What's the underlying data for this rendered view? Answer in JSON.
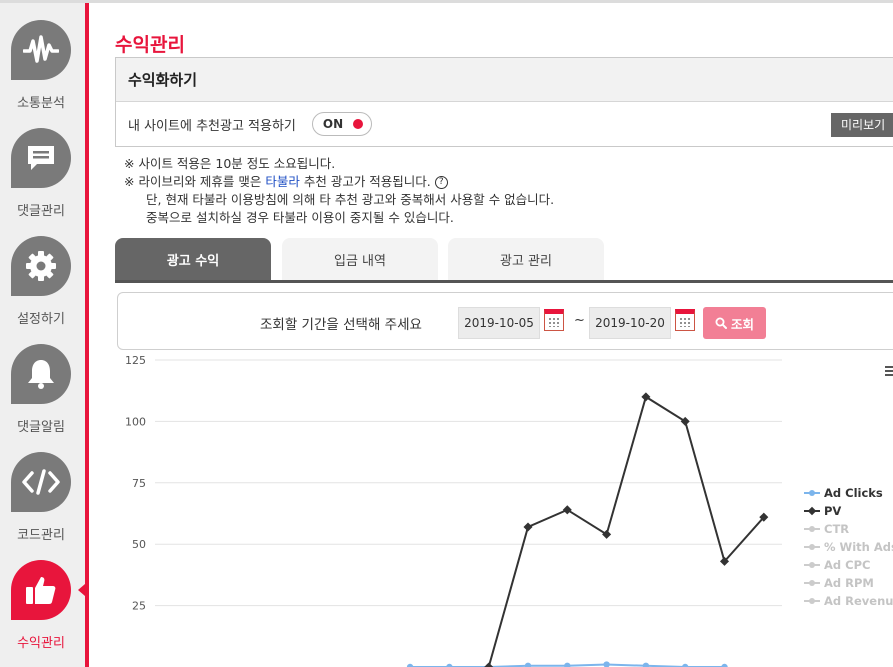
{
  "sidebar": {
    "items": [
      {
        "label": "소통분석",
        "icon": "waveform-icon",
        "active": false
      },
      {
        "label": "댓글관리",
        "icon": "speech-bubble-icon",
        "active": false
      },
      {
        "label": "설정하기",
        "icon": "gear-icon",
        "active": false
      },
      {
        "label": "댓글알림",
        "icon": "bell-icon",
        "active": false
      },
      {
        "label": "코드관리",
        "icon": "code-icon",
        "active": false
      },
      {
        "label": "수익관리",
        "icon": "thumbs-up-icon",
        "active": true
      }
    ]
  },
  "page": {
    "title": "수익관리"
  },
  "monetize_card": {
    "heading": "수익화하기",
    "row_label": "내 사이트에 추천광고 적용하기",
    "toggle_label": "ON",
    "preview_button": "미리보기"
  },
  "notes": {
    "line1": "※ 사이트 적용은 10분 정도 소요됩니다.",
    "line2_prefix": "※ 라이브리와 제휴를 맺은 ",
    "line2_link": "타불라",
    "line2_suffix": " 추천 광고가 적용됩니다.",
    "line2_help": "?",
    "line3": "단, 현재 타불라 이용방침에 의해 타 추천 광고와 중복해서 사용할 수 없습니다.",
    "line4": "중복으로 설치하실 경우 타불라 이용이 중지될 수 있습니다."
  },
  "tabs": [
    {
      "label": "광고 수익",
      "active": true
    },
    {
      "label": "입금 내역",
      "active": false
    },
    {
      "label": "광고 관리",
      "active": false
    }
  ],
  "filter": {
    "label": "조회할 기간을 선택해 주세요",
    "start_date": "2019-10-05",
    "separator": "~",
    "end_date": "2019-10-20",
    "search_button": "조회"
  },
  "colors": {
    "accent": "#e8153c",
    "search_button": "#f27f95",
    "pv_line": "#333333",
    "ad_clicks_line": "#7cb5ec",
    "legend_inactive": "#cccccc"
  },
  "chart_data": {
    "type": "line",
    "ylim": [
      0,
      125
    ],
    "y_ticks": [
      25,
      50,
      75,
      100,
      125
    ],
    "grid": true,
    "legend_position": "right",
    "series": [
      {
        "name": "Ad Clicks",
        "visible": true,
        "points": [
          [
            -3,
            0
          ],
          [
            -2,
            0
          ],
          [
            -1,
            0
          ],
          [
            0,
            0.5
          ],
          [
            1,
            0.5
          ],
          [
            2,
            1
          ],
          [
            3,
            0.5
          ],
          [
            4,
            0
          ],
          [
            5,
            0
          ]
        ]
      },
      {
        "name": "PV",
        "visible": true,
        "points": [
          [
            -1,
            0
          ],
          [
            0,
            57
          ],
          [
            1,
            64
          ],
          [
            2,
            54
          ],
          [
            3,
            110
          ],
          [
            4,
            100
          ],
          [
            5,
            43
          ],
          [
            6,
            61
          ]
        ]
      },
      {
        "name": "CTR",
        "visible": false,
        "points": []
      },
      {
        "name": "% With Ads",
        "visible": false,
        "points": []
      },
      {
        "name": "Ad CPC",
        "visible": false,
        "points": []
      },
      {
        "name": "Ad RPM",
        "visible": false,
        "points": []
      },
      {
        "name": "Ad Revenue",
        "visible": false,
        "points": []
      }
    ]
  }
}
